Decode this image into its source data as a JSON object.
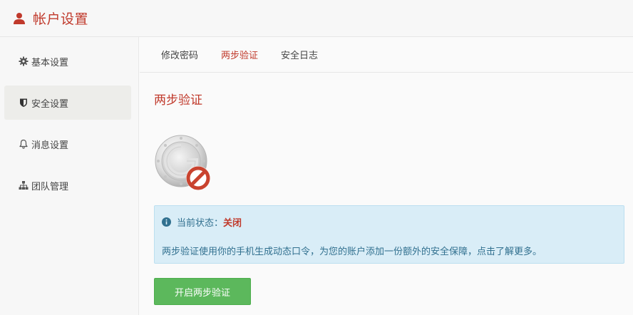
{
  "header": {
    "title": "帐户设置",
    "icon": "user-icon",
    "accent": "#c0392b"
  },
  "sidebar": {
    "items": [
      {
        "label": "基本设置",
        "icon": "gear-icon",
        "active": false
      },
      {
        "label": "安全设置",
        "icon": "shield-icon",
        "active": true
      },
      {
        "label": "消息设置",
        "icon": "bell-icon",
        "active": false
      },
      {
        "label": "团队管理",
        "icon": "sitemap-icon",
        "active": false
      }
    ]
  },
  "tabs": [
    {
      "label": "修改密码",
      "active": false
    },
    {
      "label": "两步验证",
      "active": true
    },
    {
      "label": "安全日志",
      "active": false
    }
  ],
  "main": {
    "section_title": "两步验证",
    "graphic": "authenticator-disabled-icon",
    "alert": {
      "icon": "info-icon",
      "status_label": "当前状态：",
      "status_value": "关闭",
      "description": "两步验证使用你的手机生成动态口令，为您的账户添加一份额外的安全保障，点击了解更多。"
    },
    "button_label": "开启两步验证",
    "button_color": "#5cb85c"
  }
}
